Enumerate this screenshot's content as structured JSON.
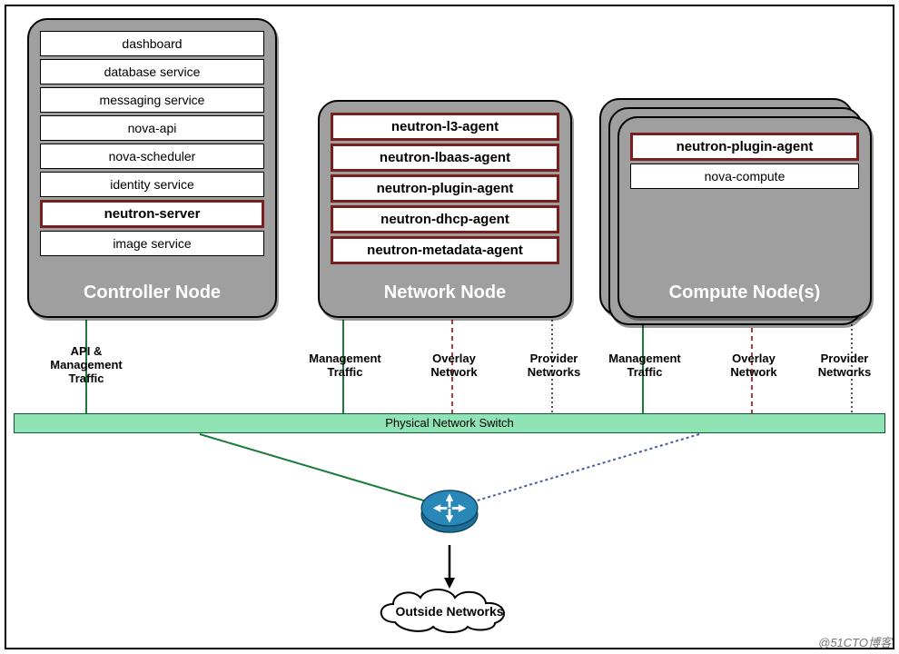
{
  "controller": {
    "title": "Controller Node",
    "services": [
      {
        "label": "dashboard",
        "highlight": false
      },
      {
        "label": "database service",
        "highlight": false
      },
      {
        "label": "messaging service",
        "highlight": false
      },
      {
        "label": "nova-api",
        "highlight": false
      },
      {
        "label": "nova-scheduler",
        "highlight": false
      },
      {
        "label": "identity service",
        "highlight": false
      },
      {
        "label": "neutron-server",
        "highlight": true
      },
      {
        "label": "image service",
        "highlight": false
      }
    ]
  },
  "network": {
    "title": "Network Node",
    "services": [
      {
        "label": "neutron-l3-agent",
        "highlight": true
      },
      {
        "label": "neutron-lbaas-agent",
        "highlight": true
      },
      {
        "label": "neutron-plugin-agent",
        "highlight": true
      },
      {
        "label": "neutron-dhcp-agent",
        "highlight": true
      },
      {
        "label": "neutron-metadata-agent",
        "highlight": true
      }
    ]
  },
  "compute": {
    "title": "Compute Node(s)",
    "services": [
      {
        "label": "neutron-plugin-agent",
        "highlight": true
      },
      {
        "label": "nova-compute",
        "highlight": false
      }
    ]
  },
  "traffic": {
    "controller_api": "API &\nManagement\nTraffic",
    "mgmt": "Management\nTraffic",
    "overlay": "Overlay\nNetwork",
    "provider": "Provider\nNetworks"
  },
  "switch_label": "Physical Network Switch",
  "outside_label": "Outside Networks",
  "watermark": "@51CTO博客",
  "colors": {
    "mgmt": "#1c7a3d",
    "overlay": "#b43a3a",
    "provider": "#555555",
    "router": "#1d6f99"
  }
}
